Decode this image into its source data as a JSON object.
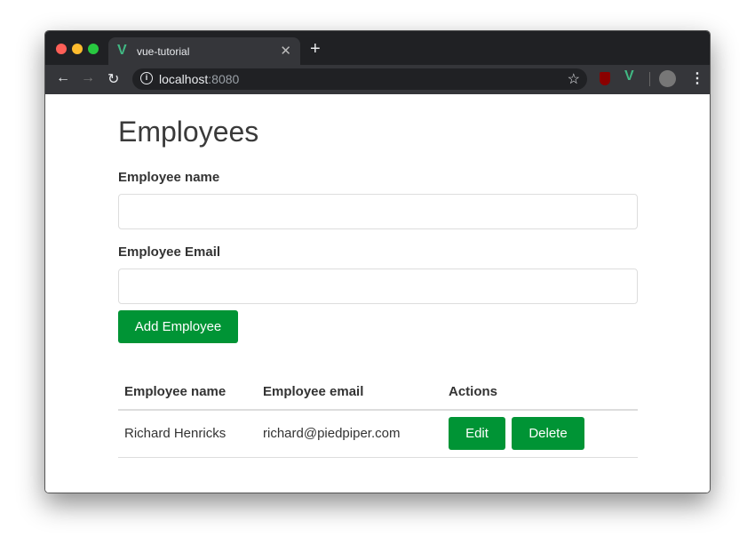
{
  "browser": {
    "tab_title": "vue-tutorial",
    "url_host": "localhost",
    "url_port": ":8080",
    "colors": {
      "close": "#ff5f57",
      "minimize": "#febc2e",
      "maximize": "#28c840"
    }
  },
  "page": {
    "title": "Employees",
    "name_label": "Employee name",
    "name_value": "",
    "email_label": "Employee Email",
    "email_value": "",
    "add_button": "Add Employee"
  },
  "table": {
    "headers": [
      "Employee name",
      "Employee email",
      "Actions"
    ],
    "rows": [
      {
        "name": "Richard Henricks",
        "email": "richard@piedpiper.com",
        "edit": "Edit",
        "delete": "Delete"
      }
    ]
  },
  "accent": "#009435"
}
